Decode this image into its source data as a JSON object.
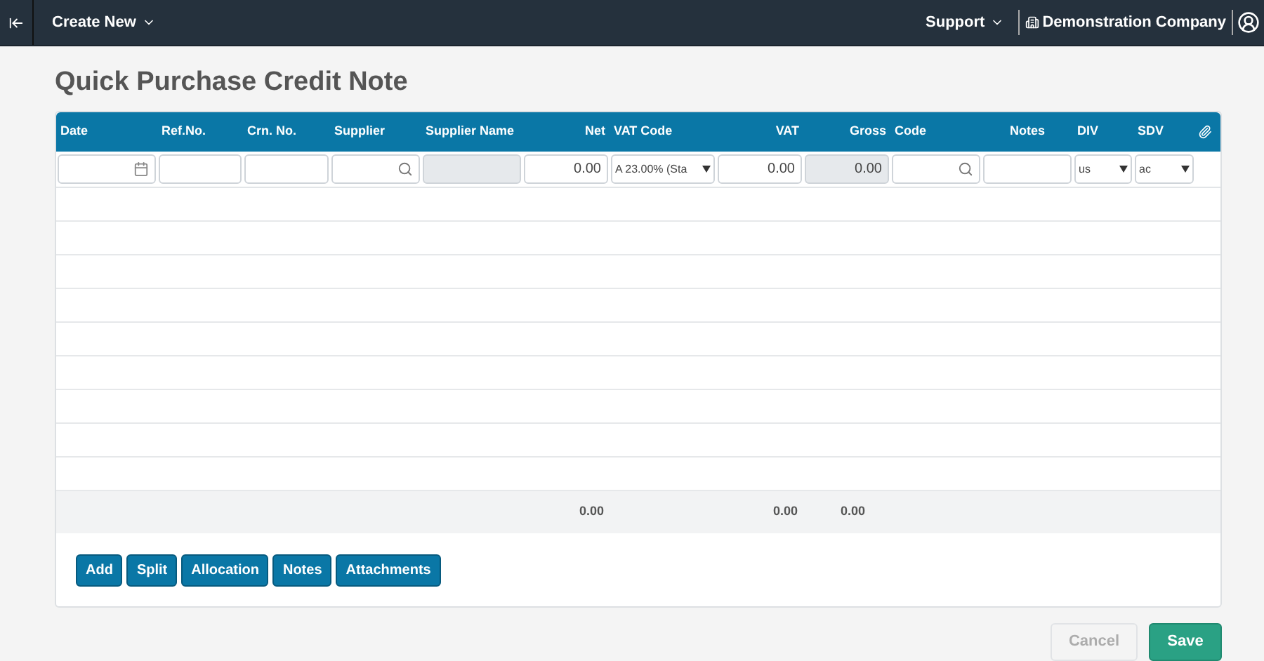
{
  "topbar": {
    "create_menu": "Create New",
    "support_menu": "Support",
    "company": "Demonstration Company"
  },
  "title": "Quick Purchase Credit Note",
  "table": {
    "columns": [
      {
        "label": "Date"
      },
      {
        "label": "Ref.No."
      },
      {
        "label": "Crn. No."
      },
      {
        "label": "Supplier"
      },
      {
        "label": "Supplier Name"
      },
      {
        "label": "Net"
      },
      {
        "label": "VAT Code"
      },
      {
        "label": "VAT"
      },
      {
        "label": "Gross"
      },
      {
        "label": "Code"
      },
      {
        "label": "Notes"
      },
      {
        "label": "DIV"
      },
      {
        "label": "SDV"
      }
    ],
    "entry_row": [
      {
        "kind": "date",
        "disabled": false
      },
      {
        "kind": "text",
        "disabled": false
      },
      {
        "kind": "text",
        "disabled": false
      },
      {
        "kind": "search",
        "disabled": false
      },
      {
        "kind": "text",
        "disabled": true
      },
      {
        "kind": "text",
        "disabled": false,
        "value": "0.00"
      },
      {
        "kind": "select",
        "disabled": false,
        "value": "A 23.00% (Sta"
      },
      {
        "kind": "text",
        "disabled": false,
        "value": "0.00"
      },
      {
        "kind": "text",
        "disabled": true,
        "value": "0.00"
      },
      {
        "kind": "search",
        "disabled": false
      },
      {
        "kind": "text",
        "disabled": false
      },
      {
        "kind": "select",
        "disabled": false,
        "value": "us"
      },
      {
        "kind": "select",
        "disabled": false,
        "value": "ac"
      }
    ],
    "totals": {
      "net": "0.00",
      "vat": "0.00",
      "gross": "0.00"
    }
  },
  "actions": [
    {
      "label": "Add"
    },
    {
      "label": "Split"
    },
    {
      "label": "Allocation"
    },
    {
      "label": "Notes"
    },
    {
      "label": "Attachments"
    }
  ],
  "footer_buttons": [
    {
      "label": "Cancel",
      "kind": "secondary",
      "disabled": true
    },
    {
      "label": "Save",
      "kind": "primary",
      "disabled": false
    }
  ]
}
